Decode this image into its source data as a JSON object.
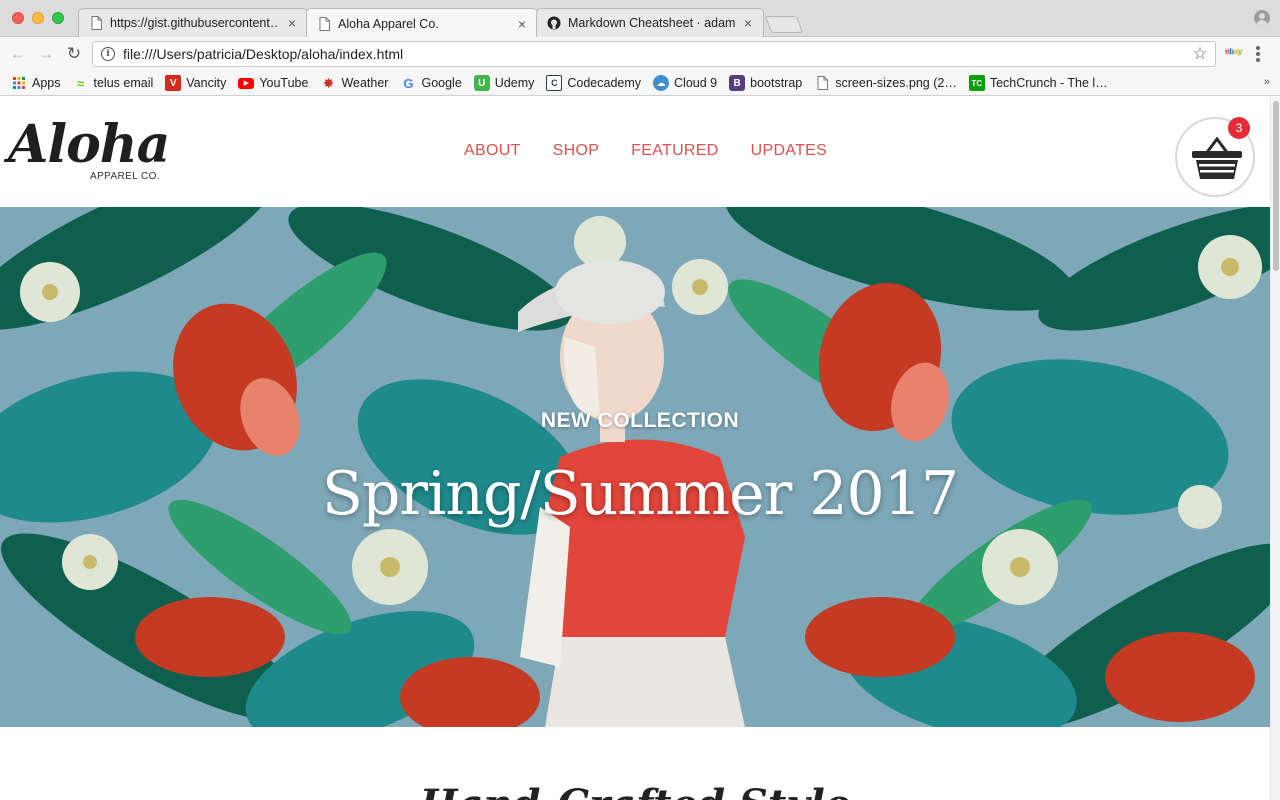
{
  "browser": {
    "tabs": [
      {
        "title": "https://gist.githubusercontent…",
        "active": false
      },
      {
        "title": "Aloha Apparel Co.",
        "active": true
      },
      {
        "title": "Markdown Cheatsheet · adam-p…",
        "active": false
      }
    ],
    "close_glyph": "×",
    "url": "file:///Users/patricia/Desktop/aloha/index.html",
    "nav": {
      "back": "←",
      "forward": "→",
      "reload": "↻"
    },
    "star_glyph": "☆",
    "extension_label": "ebay",
    "bookmarks": [
      {
        "label": "Apps",
        "icon": "apps-grid-icon",
        "color": "#4285f4"
      },
      {
        "label": "telus email",
        "icon": "telus-icon",
        "color": "#4b286d"
      },
      {
        "label": "Vancity",
        "icon": "vancity-icon",
        "color": "#d52b1e"
      },
      {
        "label": "YouTube",
        "icon": "youtube-icon",
        "color": "#ff0000"
      },
      {
        "label": "Weather",
        "icon": "maple-leaf-icon",
        "color": "#d52b1e"
      },
      {
        "label": "Google",
        "icon": "google-icon",
        "color": "#4285f4"
      },
      {
        "label": "Udemy",
        "icon": "udemy-icon",
        "color": "#44b549"
      },
      {
        "label": "Codecademy",
        "icon": "codecademy-icon",
        "color": "#204056"
      },
      {
        "label": "Cloud 9",
        "icon": "cloud9-icon",
        "color": "#3d8fce"
      },
      {
        "label": "bootstrap",
        "icon": "bootstrap-icon",
        "color": "#563d7c"
      },
      {
        "label": "screen-sizes.png (2…",
        "icon": "file-icon",
        "color": "#777777"
      },
      {
        "label": "TechCrunch - The l…",
        "icon": "techcrunch-icon",
        "color": "#0a9e01"
      }
    ],
    "bookmarks_overflow": "»"
  },
  "site": {
    "logo": {
      "script": "Aloha",
      "sub": "APPAREL CO."
    },
    "nav": [
      {
        "label": "ABOUT"
      },
      {
        "label": "SHOP"
      },
      {
        "label": "FEATURED"
      },
      {
        "label": "UPDATES"
      }
    ],
    "cart_count": "3",
    "hero": {
      "kicker": "NEW COLLECTION",
      "title": "Spring/Summer 2017"
    },
    "section_heading": "Hand-Crafted Style"
  },
  "colors": {
    "nav_accent": "#e0514e",
    "badge": "#e8293a",
    "hero_bg": "#7ea8b8"
  }
}
